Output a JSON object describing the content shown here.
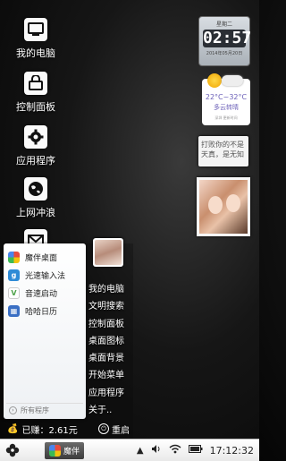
{
  "desktop": {
    "icons": [
      {
        "label": "我的电脑",
        "icon": "monitor-icon"
      },
      {
        "label": "控制面板",
        "icon": "lock-panel-icon"
      },
      {
        "label": "应用程序",
        "icon": "gear-icon"
      },
      {
        "label": "上网冲浪",
        "icon": "globe-icon"
      },
      {
        "label": "",
        "icon": "mail-icon"
      }
    ]
  },
  "widgets": {
    "clock": {
      "day": "星期二",
      "time": "02:57",
      "date": "2014年05月20日"
    },
    "weather": {
      "temp": "22°C~32°C",
      "condition": "多云转晴",
      "city": "深圳",
      "update": "更新时间"
    },
    "note": {
      "text": "打败你的不是天真，是无知"
    }
  },
  "start_menu": {
    "apps": [
      {
        "label": "魔伴桌面",
        "icon": "mobo-desktop-icon",
        "color": "#ffffff"
      },
      {
        "label": "光速输入法",
        "icon": "input-method-icon",
        "color": "#2e8bd6"
      },
      {
        "label": "音速启动",
        "icon": "quick-launch-icon",
        "color": "#4ea34a"
      },
      {
        "label": "哈哈日历",
        "icon": "calendar-icon",
        "color": "#3a6fc4"
      }
    ],
    "all_programs": "所有程序",
    "right_items": [
      "我的电脑",
      "文明搜索",
      "控制面板",
      "桌面图标",
      "桌面背景",
      "开始菜单",
      "应用程序",
      "关于.."
    ],
    "earned": "已赚：2.61元",
    "restart": "重启"
  },
  "taskbar": {
    "app_label": "魔伴",
    "clock": "17:12:32"
  }
}
